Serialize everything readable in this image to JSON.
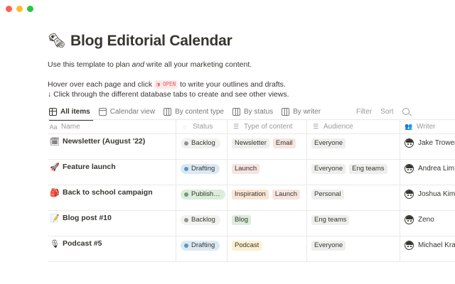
{
  "window": {
    "controls": [
      "close",
      "minimize",
      "zoom"
    ]
  },
  "page": {
    "icon": "newspaper-icon",
    "icon_glyph": "🗞",
    "title": "Blog Editorial Calendar",
    "description_line1_before": "Use this template to plan ",
    "description_line1_em": "and",
    "description_line1_after": " write all your marketing content.",
    "description_line2_before": "Hover over each page and click ",
    "open_chip": "◨ OPEN",
    "description_line2_after": " to write your outlines and drafts.",
    "description_line3": "↓ Click through the different database tabs to create and see other views."
  },
  "tabs": [
    {
      "label": "All items",
      "icon": "table-icon"
    },
    {
      "label": "Calendar view",
      "icon": "calendar-icon"
    },
    {
      "label": "By content type",
      "icon": "board-icon"
    },
    {
      "label": "By status",
      "icon": "board-icon"
    },
    {
      "label": "By writer",
      "icon": "board-icon"
    }
  ],
  "toolbar": {
    "filter": "Filter",
    "sort": "Sort",
    "search_icon": "search-icon"
  },
  "columns": {
    "name": {
      "label": "Name",
      "icon_glyph": "Aa"
    },
    "status": {
      "label": "Status",
      "icon_glyph": "◌"
    },
    "type": {
      "label": "Type of content",
      "icon_glyph": "☰"
    },
    "audience": {
      "label": "Audience",
      "icon_glyph": "☰"
    },
    "writer": {
      "label": "Writer",
      "icon_glyph": "👥"
    }
  },
  "colors": {
    "backlog_bg": "#f1f1ef",
    "backlog_dot": "#91918e",
    "drafting_bg": "#dbe9f4",
    "drafting_dot": "#5b97bd",
    "published_bg": "#dbeddb",
    "published_dot": "#6c9b7d",
    "tag_gray": "#eeeeec",
    "tag_red": "#f6e4e0",
    "tag_orange": "#f9e5d3",
    "tag_green": "#dbeddb",
    "tag_yellow": "#fbf0cf"
  },
  "rows": [
    {
      "emoji": "🗓",
      "name": "Newsletter (August '22)",
      "status": {
        "label": "Backlog",
        "kind": "backlog"
      },
      "types": [
        {
          "label": "Newsletter",
          "color": "gray"
        },
        {
          "label": "Email",
          "color": "red"
        }
      ],
      "audience": [
        "Everyone"
      ],
      "writer": "Jake Trower"
    },
    {
      "emoji": "🚀",
      "name": "Feature launch",
      "status": {
        "label": "Drafting",
        "kind": "drafting"
      },
      "types": [
        {
          "label": "Launch",
          "color": "red"
        }
      ],
      "audience": [
        "Everyone",
        "Eng teams"
      ],
      "writer": "Andrea Lim"
    },
    {
      "emoji": "🎒",
      "name": "Back to school campaign",
      "status": {
        "label": "Publish…",
        "kind": "published"
      },
      "types": [
        {
          "label": "Inspiration",
          "color": "orange"
        },
        {
          "label": "Launch",
          "color": "red"
        }
      ],
      "audience": [
        "Personal"
      ],
      "writer": "Joshua Kim"
    },
    {
      "emoji": "📝",
      "name": "Blog post #10",
      "status": {
        "label": "Backlog",
        "kind": "backlog"
      },
      "types": [
        {
          "label": "Blog",
          "color": "green"
        }
      ],
      "audience": [
        "Eng teams"
      ],
      "writer": "Zeno"
    },
    {
      "emoji": "🎙",
      "name": "Podcast #5",
      "status": {
        "label": "Drafting",
        "kind": "drafting"
      },
      "types": [
        {
          "label": "Podcast",
          "color": "yellow"
        }
      ],
      "audience": [
        "Everyone"
      ],
      "writer": "Michael Kra"
    }
  ]
}
